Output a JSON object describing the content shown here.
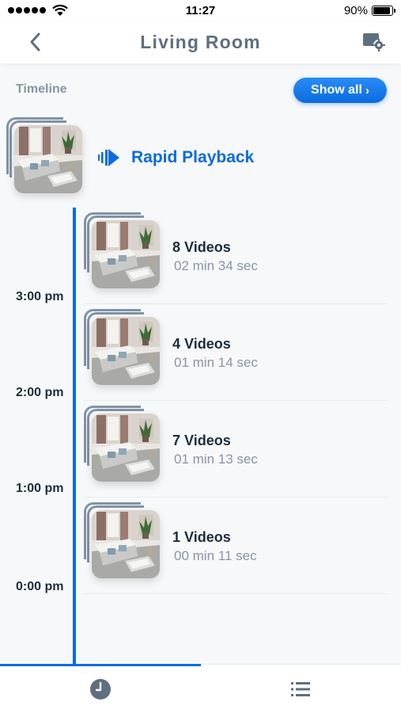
{
  "status_bar": {
    "time": "11:27",
    "battery_percent": "90%",
    "battery_level": 0.9,
    "signal_bars": 5
  },
  "nav": {
    "title": "Living Room",
    "back_icon": "chevron-left-icon",
    "settings_icon": "camera-settings-icon"
  },
  "timeline": {
    "label": "Timeline",
    "show_all_label": "Show all",
    "rapid_playback_label": "Rapid Playback",
    "time_labels": [
      "3:00 pm",
      "2:00 pm",
      "1:00 pm",
      "0:00 pm"
    ],
    "events": [
      {
        "count": "8 Videos",
        "duration": "02 min 34 sec"
      },
      {
        "count": "4 Videos",
        "duration": "01 min 14 sec"
      },
      {
        "count": "7 Videos",
        "duration": "01 min 13 sec"
      },
      {
        "count": "1 Videos",
        "duration": "00 min 11 sec"
      }
    ]
  },
  "tab_bar": {
    "tabs": [
      "clock-icon",
      "list-icon"
    ],
    "active_tab": "clock-icon"
  },
  "colors": {
    "accent": "#0a6be0",
    "muted_text": "#8696a5",
    "dark_text": "#1e2d3d"
  }
}
